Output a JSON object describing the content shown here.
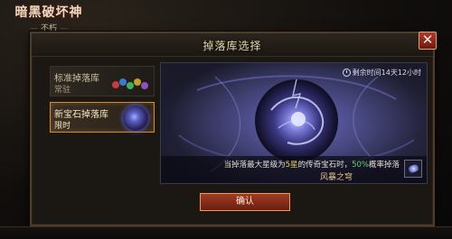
{
  "game_logo": {
    "title": "暗黑破坏神",
    "subtitle": "不朽"
  },
  "dialog": {
    "title": "掉落库选择",
    "close_label": "✕",
    "loot_pools": [
      {
        "name": "标准掉落库",
        "subtitle": "常驻",
        "selected": false
      },
      {
        "name": "新宝石掉落库",
        "subtitle": "限时",
        "selected": true
      }
    ],
    "preview": {
      "timer_text": "剩余时间14天12小时",
      "description": {
        "part1": "当掉落最大星级为",
        "star": "5星",
        "part2": "的传奇宝石时，",
        "percent": "50%",
        "part3": "概率掉落"
      },
      "gem_name": "风暴之穹"
    },
    "confirm_label": "确认"
  },
  "colors": {
    "accent_red": "#a03c22",
    "selected_border": "#d08a3a",
    "highlight_star": "#e8c860",
    "highlight_percent": "#6ed070",
    "gem_name": "#e8c88a"
  },
  "icons": [
    "close-icon",
    "clock-icon",
    "gem-icon",
    "orb-icon",
    "gems-icon"
  ]
}
